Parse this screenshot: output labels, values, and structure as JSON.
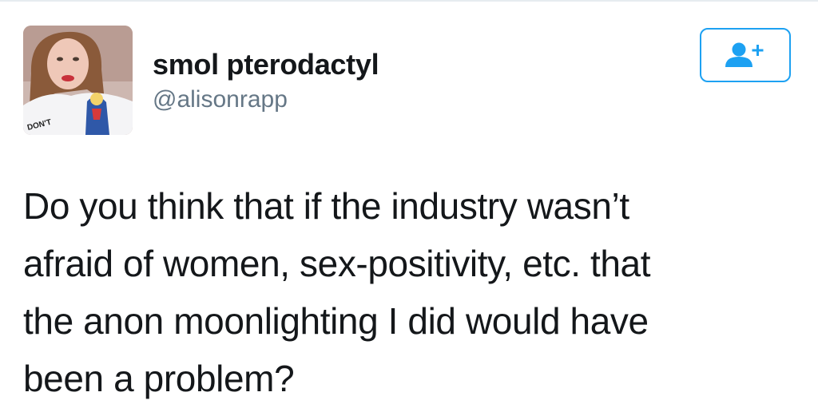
{
  "user": {
    "display_name": "smol pterodactyl",
    "handle": "@alisonrapp",
    "avatar_shirt_text": "DON'T"
  },
  "follow_button": {
    "icon": "add-user-icon",
    "color": "#1da1f2"
  },
  "tweet": {
    "lines": [
      "Do you think that if the industry wasn’t",
      "afraid of women, sex-positivity, etc. that",
      "the anon moonlighting I did would have",
      "been a problem?"
    ]
  },
  "colors": {
    "text": "#14171a",
    "secondary_text": "#657786",
    "accent": "#1da1f2",
    "divider": "#e6ecf0"
  }
}
